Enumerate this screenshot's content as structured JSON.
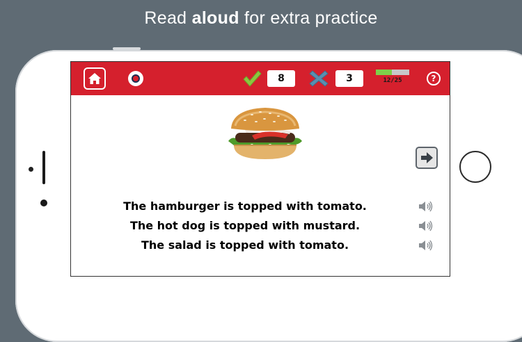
{
  "banner": {
    "prefix": "Read ",
    "bold": "aloud",
    "suffix": " for extra practice"
  },
  "score": {
    "correct": "8",
    "wrong": "3"
  },
  "progress": {
    "label": "12/25",
    "current": 12,
    "total": 25,
    "fraction": 0.48
  },
  "help": {
    "label": "?"
  },
  "sentences": [
    "The hamburger is topped with tomato.",
    "The hot dog is topped with mustard.",
    "The salad is topped with tomato."
  ],
  "colors": {
    "toolbar": "#d5202d",
    "check": "#8cc63f",
    "progress_fill": "#7ed04a",
    "background": "#5f6b74"
  },
  "icons": [
    "home-icon",
    "record-icon",
    "checkmark-icon",
    "cross-icon",
    "help-icon",
    "next-arrow-icon",
    "speaker-icon"
  ]
}
